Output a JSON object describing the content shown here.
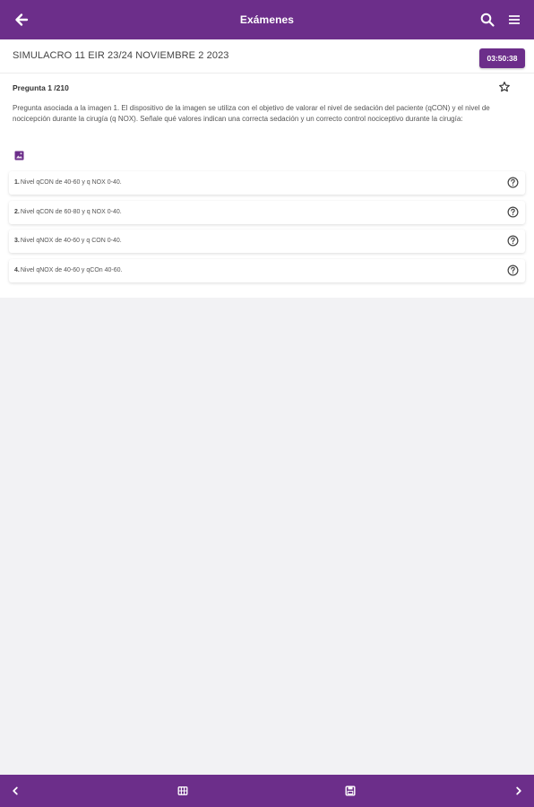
{
  "header": {
    "title": "Exámenes",
    "back_icon": "arrow-left-icon",
    "search_icon": "search-icon",
    "menu_icon": "list-icon"
  },
  "exam": {
    "title": "SIMULACRO 11 EIR 23/24 NOVIEMBRE 2 2023",
    "timer": "03:50:38"
  },
  "question": {
    "header": "Pregunta 1 /210",
    "text": "Pregunta asociada a la imagen 1. El dispositivo de la imagen se utiliza con el objetivo de valorar el nivel de sedación del paciente (qCON) y el nivel de nocicepción durante la cirugía (q NOX). Señale qué valores indican una correcta sedación y un correcto control nociceptivo durante la cirugía:",
    "favorite_icon": "star-outline-icon",
    "image_icon": "image-icon"
  },
  "options": [
    {
      "num": "1.",
      "text": "Nivel qCON de 40-60 y q NOX 0-40."
    },
    {
      "num": "2.",
      "text": "Nivel qCON de 60-80 y q NOX 0-40."
    },
    {
      "num": "3.",
      "text": "Nivel qNOX de 40-60 y q CON 0-40."
    },
    {
      "num": "4.",
      "text": "Nivel qNOX de 40-60 y qCOn 40-60."
    }
  ],
  "footer": {
    "prev_icon": "chevron-left-icon",
    "grid_icon": "grid-icon",
    "submit_icon": "save-exam-icon",
    "next_icon": "chevron-right-icon"
  },
  "colors": {
    "primary": "#6c2e8a",
    "background": "#f2f2f4"
  }
}
